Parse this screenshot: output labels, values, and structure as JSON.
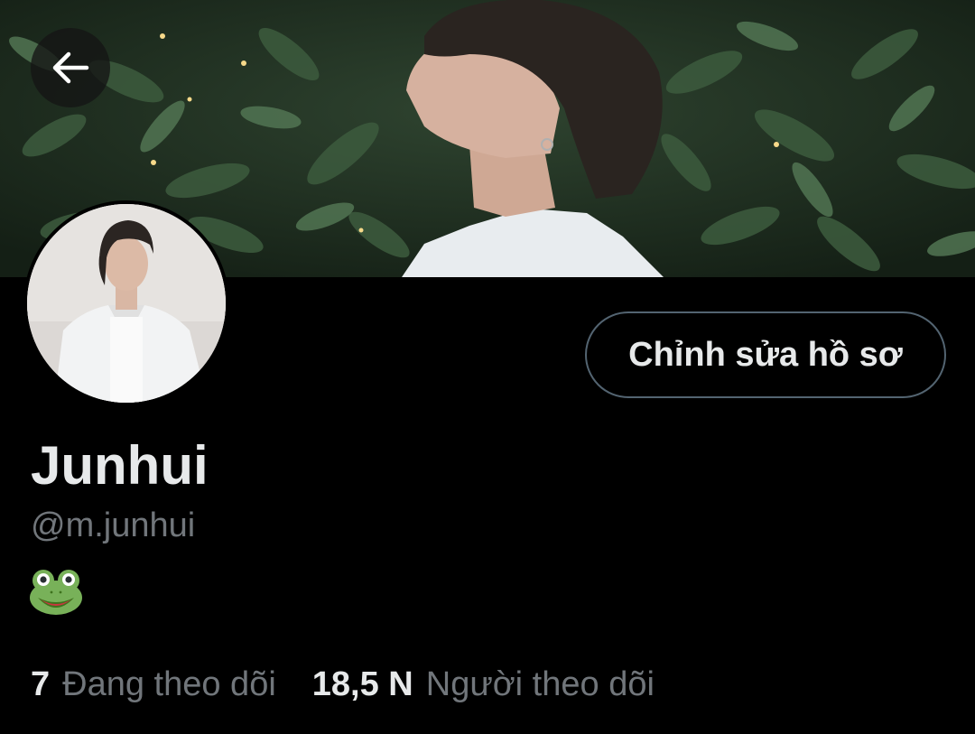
{
  "header": {
    "back_icon": "arrow-left-icon",
    "banner_alt": "banner-photo"
  },
  "profile": {
    "display_name": "Junhui",
    "handle": "@m.junhui",
    "bio_emoji_icon": "frog-face-icon",
    "edit_button_label": "Chỉnh sửa hồ sơ"
  },
  "stats": {
    "following_count": "7",
    "following_label": "Đang theo dõi",
    "followers_count": "18,5 N",
    "followers_label": "Người theo dõi"
  },
  "colors": {
    "background": "#000000",
    "primary_text": "#e7e9ea",
    "secondary_text": "#71767b",
    "button_border": "#536471"
  }
}
